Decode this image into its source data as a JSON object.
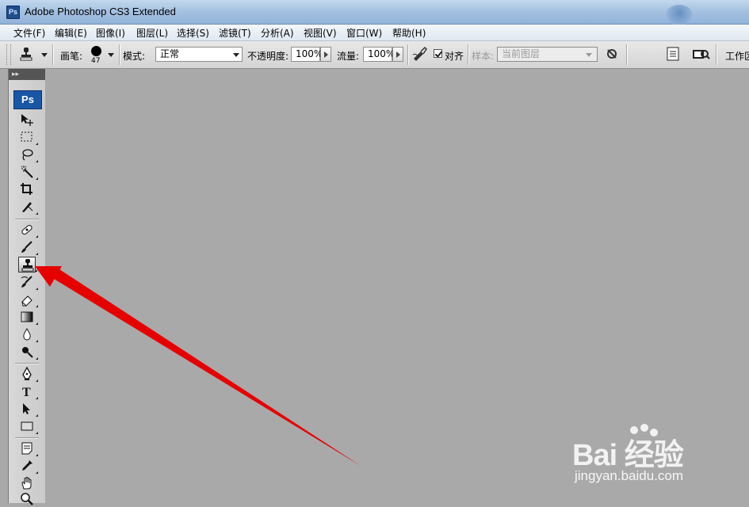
{
  "window": {
    "title": "Adobe Photoshop CS3 Extended",
    "app_icon_text": "Ps"
  },
  "menu": [
    {
      "label": "文件(F)"
    },
    {
      "label": "编辑(E)"
    },
    {
      "label": "图像(I)"
    },
    {
      "label": "图层(L)"
    },
    {
      "label": "选择(S)"
    },
    {
      "label": "滤镜(T)"
    },
    {
      "label": "分析(A)"
    },
    {
      "label": "视图(V)"
    },
    {
      "label": "窗口(W)"
    },
    {
      "label": "帮助(H)"
    }
  ],
  "options": {
    "brush_label": "画笔:",
    "brush_size": "47",
    "mode_label": "模式:",
    "mode_value": "正常",
    "opacity_label": "不透明度:",
    "opacity_value": "100%",
    "flow_label": "流量:",
    "flow_value": "100%",
    "align_label": "对齐",
    "align_checked": true,
    "sample_label": "样本:",
    "sample_value": "当前图层",
    "workspace_label": "工作区"
  },
  "toolbox": {
    "logo": "Ps",
    "selected_tool": "clone-stamp-tool",
    "tools": [
      {
        "name": "move-tool"
      },
      {
        "name": "marquee-tool"
      },
      {
        "name": "lasso-tool"
      },
      {
        "name": "magic-wand-tool"
      },
      {
        "name": "crop-tool"
      },
      {
        "name": "slice-tool"
      },
      {
        "name": "healing-brush-tool"
      },
      {
        "name": "brush-tool"
      },
      {
        "name": "clone-stamp-tool"
      },
      {
        "name": "history-brush-tool"
      },
      {
        "name": "eraser-tool"
      },
      {
        "name": "gradient-tool"
      },
      {
        "name": "blur-tool"
      },
      {
        "name": "dodge-tool"
      },
      {
        "name": "pen-tool"
      },
      {
        "name": "type-tool"
      },
      {
        "name": "path-selection-tool"
      },
      {
        "name": "rectangle-tool"
      },
      {
        "name": "notes-tool"
      },
      {
        "name": "eyedropper-tool"
      },
      {
        "name": "hand-tool"
      },
      {
        "name": "zoom-tool"
      }
    ]
  },
  "annotation": {
    "arrow_color": "#e60000",
    "points_to": "clone-stamp-tool"
  },
  "watermark": {
    "brand": "Bai 经验",
    "url": "jingyan.baidu.com"
  }
}
